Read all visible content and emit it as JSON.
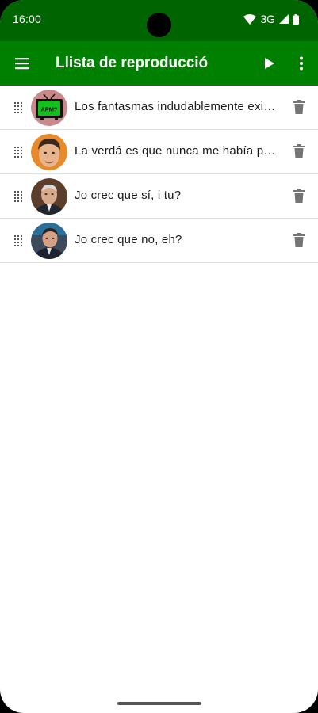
{
  "status_bar": {
    "time": "16:00",
    "network": "3G"
  },
  "app_bar": {
    "title": "Llista de reproducció",
    "menu_icon": "hamburger-menu-icon",
    "play_icon": "play-icon",
    "more_icon": "more-vert-icon",
    "color": "#008000",
    "status_color": "#006400"
  },
  "playlist": {
    "items": [
      {
        "text": "Los fantasmas indudablemente existen",
        "avatar": "tv-apm-avatar"
      },
      {
        "text": "La verdá es que nunca me había preguntado",
        "avatar": "man-portrait-avatar"
      },
      {
        "text": "Jo crec que sí, i tu?",
        "avatar": "politician-portrait-avatar"
      },
      {
        "text": "Jo crec que no, eh?",
        "avatar": "politician-portrait-avatar"
      }
    ],
    "tv_logo_text": "APM?",
    "drag_icon": "drag-handle-icon",
    "delete_icon": "trash-icon"
  }
}
